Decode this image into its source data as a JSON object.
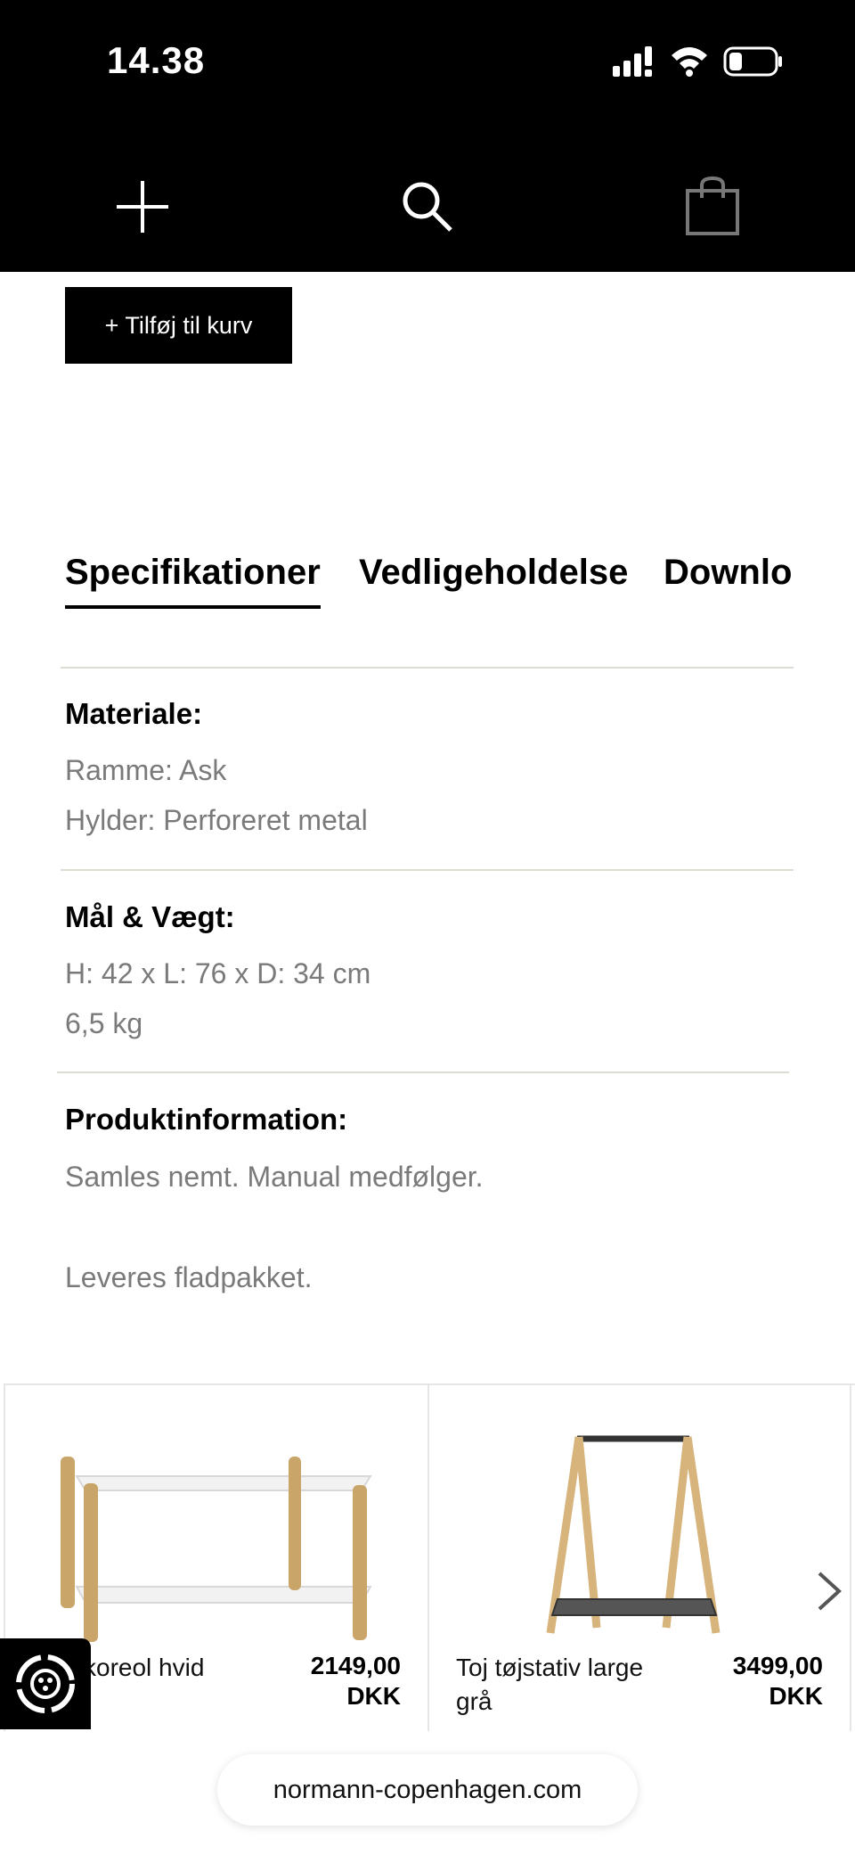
{
  "status_bar": {
    "time": "14.38"
  },
  "actions": {
    "add_to_cart": "+ Tilføj til kurv"
  },
  "tabs": [
    {
      "label": "Specifikationer",
      "active": true
    },
    {
      "label": "Vedligeholdelse",
      "active": false
    },
    {
      "label": "Downlo",
      "active": false
    }
  ],
  "specs": {
    "material": {
      "title": "Materiale:",
      "lines": [
        "Ramme: Ask",
        "Hylder: Perforeret metal"
      ]
    },
    "dimensions": {
      "title": "Mål & Vægt:",
      "lines": [
        "H: 42 x L: 76 x D: 34 cm",
        "6,5 kg"
      ]
    },
    "info": {
      "title": "Produktinformation:",
      "lines": [
        "Samles nemt. Manual medfølger.",
        "Leveres fladpakket."
      ]
    }
  },
  "products": [
    {
      "name": "koreol hvid",
      "price": "2149,00",
      "currency": "DKK"
    },
    {
      "name": "Toj tøjstativ large grå",
      "price": "3499,00",
      "currency": "DKK"
    }
  ],
  "browser": {
    "url": "normann-copenhagen.com"
  },
  "colors": {
    "header_bg": "#000000",
    "button_bg": "#000000",
    "divider": "#dcdcd2",
    "secondary_text": "#7a7a7a"
  },
  "icons": [
    "menu-icon",
    "search-icon",
    "shopping-bag-icon",
    "chevron-right-icon",
    "accessibility-icon",
    "wifi-icon",
    "signal-icon",
    "battery-icon"
  ]
}
